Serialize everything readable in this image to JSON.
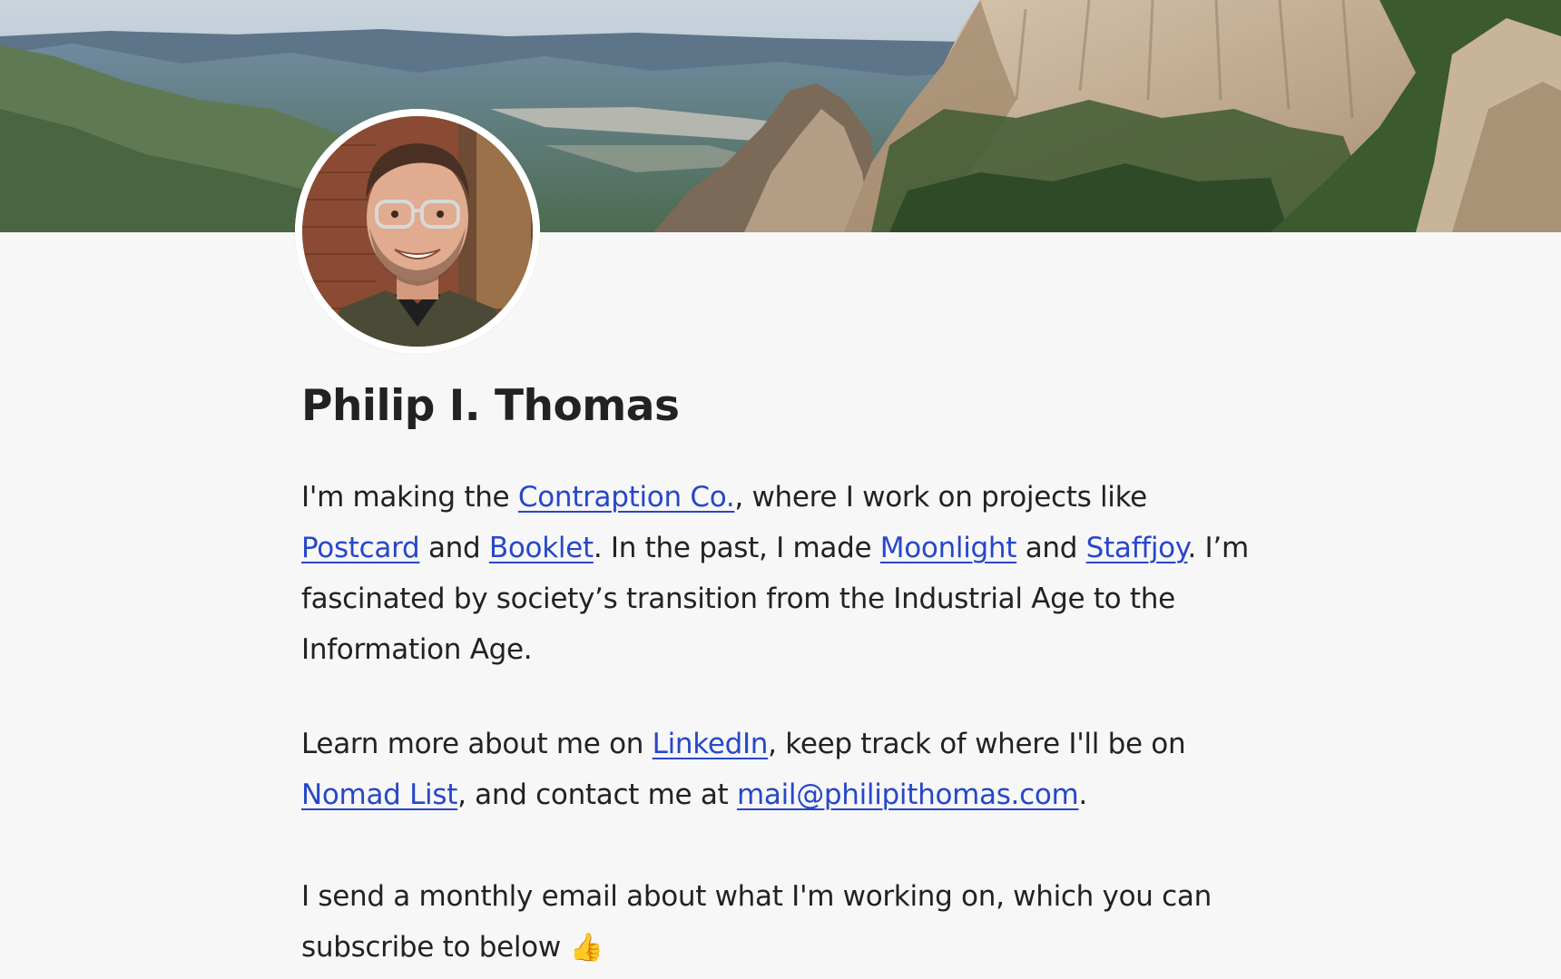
{
  "profile": {
    "name": "Philip I. Thomas"
  },
  "intro": {
    "t1": "I'm making the ",
    "link_contraption": "Contraption Co.",
    "t2": ", where I work on projects like ",
    "link_postcard": "Postcard",
    "t3": " and ",
    "link_booklet": "Booklet",
    "t4": ". In the past, I made ",
    "link_moonlight": "Moonlight",
    "t5": " and ",
    "link_staffjoy": "Staffjoy",
    "t6": ". I’m fascinated by society’s transition from the Industrial Age to the Information Age."
  },
  "contact": {
    "t1": "Learn more about me on ",
    "link_linkedin": "LinkedIn",
    "t2": ", keep track of where I'll be on ",
    "link_nomad": "Nomad List",
    "t3": ", and contact me at ",
    "link_email": "mail@philipithomas.com",
    "t4": "."
  },
  "newsletter": {
    "text": "I send a monthly email about what I'm working on, which you can subscribe to below ",
    "emoji": "👍"
  },
  "colors": {
    "background": "#f7f7f8",
    "text": "#222222",
    "link": "#2747c9"
  },
  "icons": {
    "banner": "mountain-landscape-image",
    "avatar": "profile-photo"
  }
}
